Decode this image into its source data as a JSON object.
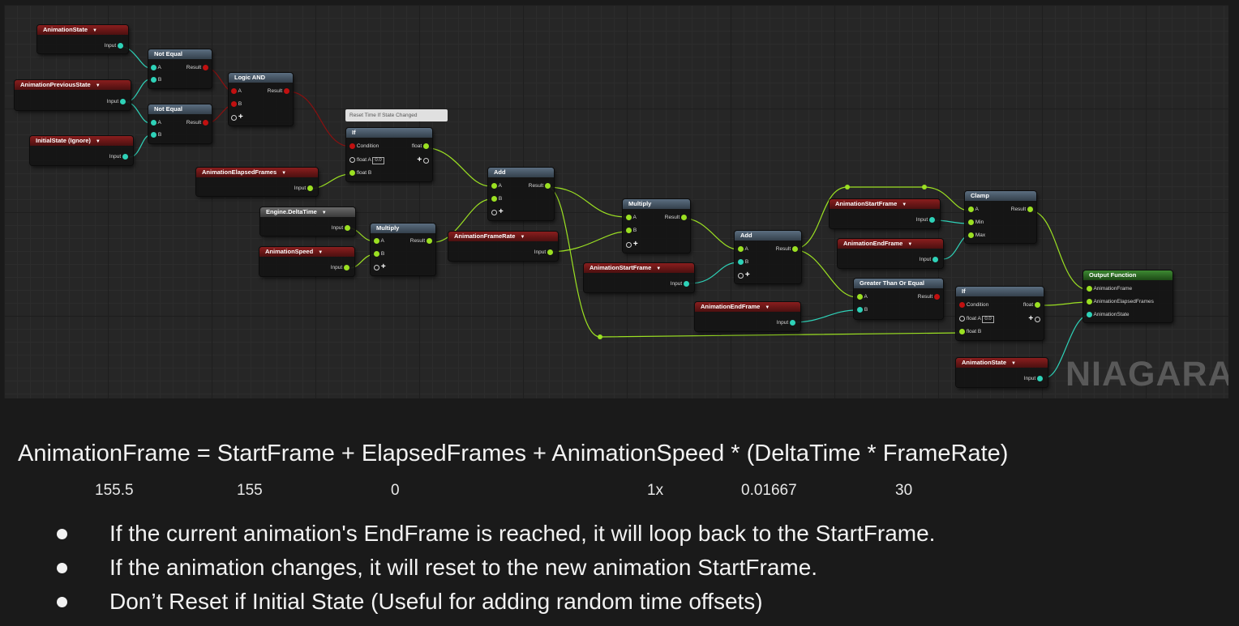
{
  "graph": {
    "watermark": "NIAGARA",
    "comment": "Reset Time If State Changed",
    "nodes": {
      "animation_state_top": {
        "title": "AnimationState",
        "pins": {
          "input": "Input"
        }
      },
      "animation_previous_state": {
        "title": "AnimationPreviousState",
        "pins": {
          "input": "Input"
        }
      },
      "initial_state": {
        "title": "InitialState (Ignore)",
        "pins": {
          "input": "Input"
        }
      },
      "not_equal_1": {
        "title": "Not Equal",
        "pins": {
          "a": "A",
          "b": "B",
          "result": "Result"
        }
      },
      "not_equal_2": {
        "title": "Not Equal",
        "pins": {
          "a": "A",
          "b": "B",
          "result": "Result"
        }
      },
      "logic_and": {
        "title": "Logic AND",
        "pins": {
          "a": "A",
          "b": "B",
          "result": "Result"
        }
      },
      "if_1": {
        "title": "If",
        "pins": {
          "condition": "Condition",
          "float_out": "float",
          "float_a": "float A",
          "float_a_value": "0.0",
          "float_b": "float B"
        }
      },
      "elapsed_frames": {
        "title": "AnimationElapsedFrames",
        "pins": {
          "input": "Input"
        }
      },
      "engine_delta_time": {
        "title": "Engine.DeltaTime",
        "pins": {
          "input": "Input"
        }
      },
      "animation_speed": {
        "title": "AnimationSpeed",
        "pins": {
          "input": "Input"
        }
      },
      "multiply_1": {
        "title": "Multiply",
        "pins": {
          "a": "A",
          "b": "B",
          "result": "Result"
        }
      },
      "add_1": {
        "title": "Add",
        "pins": {
          "a": "A",
          "b": "B",
          "result": "Result"
        }
      },
      "frame_rate": {
        "title": "AnimationFrameRate",
        "pins": {
          "input": "Input"
        }
      },
      "multiply_2": {
        "title": "Multiply",
        "pins": {
          "a": "A",
          "b": "B",
          "result": "Result"
        }
      },
      "start_frame_1": {
        "title": "AnimationStartFrame",
        "pins": {
          "input": "Input"
        }
      },
      "add_2": {
        "title": "Add",
        "pins": {
          "a": "A",
          "b": "B",
          "result": "Result"
        }
      },
      "end_frame_1": {
        "title": "AnimationEndFrame",
        "pins": {
          "input": "Input"
        }
      },
      "start_frame_2": {
        "title": "AnimationStartFrame",
        "pins": {
          "input": "Input"
        }
      },
      "end_frame_2": {
        "title": "AnimationEndFrame",
        "pins": {
          "input": "Input"
        }
      },
      "clamp": {
        "title": "Clamp",
        "pins": {
          "a": "A",
          "min": "Min",
          "max": "Max",
          "result": "Result"
        }
      },
      "greater_equal": {
        "title": "Greater Than Or Equal",
        "pins": {
          "a": "A",
          "b": "B",
          "result": "Result"
        }
      },
      "if_2": {
        "title": "If",
        "pins": {
          "condition": "Condition",
          "float_out": "float",
          "float_a": "float A",
          "float_a_value": "0.0",
          "float_b": "float B"
        }
      },
      "animation_state_bottom": {
        "title": "AnimationState",
        "pins": {
          "input": "Input"
        }
      },
      "output_function": {
        "title": "Output Function",
        "pins": {
          "frame": "AnimationFrame",
          "elapsed": "AnimationElapsedFrames",
          "state": "AnimationState"
        }
      }
    }
  },
  "formula": {
    "text": "AnimationFrame = StartFrame + ElapsedFrames + AnimationSpeed * (DeltaTime * FrameRate)",
    "values": [
      "155.5",
      "155",
      "0",
      "1x",
      "0.01667",
      "30"
    ]
  },
  "bullets": [
    "If the current animation's EndFrame is reached, it will loop back to the StartFrame.",
    "If the animation changes, it will reset to the new animation StartFrame.",
    "Don’t Reset if Initial State (Useful for adding random time offsets)"
  ],
  "colors": {
    "float_pin": "#9be022",
    "int_pin": "#2ed2b8",
    "bool_pin": "#c01010",
    "parameter_header": "#8a1e1e",
    "operator_header": "#5b6e80",
    "output_header": "#3d8a32"
  }
}
